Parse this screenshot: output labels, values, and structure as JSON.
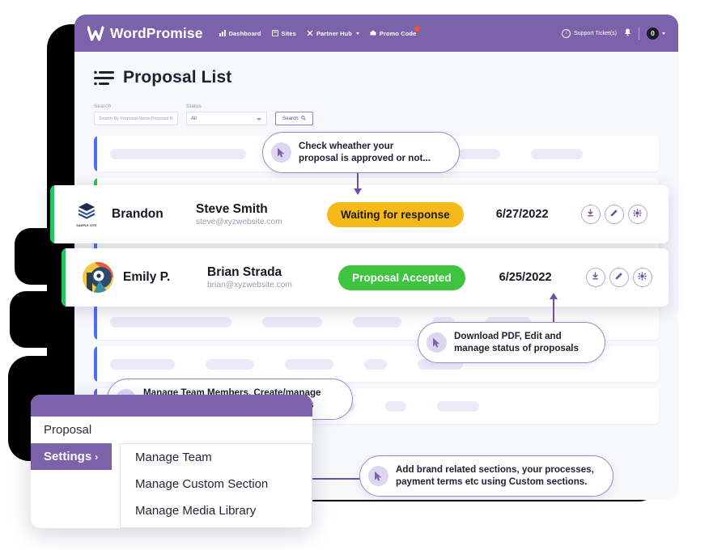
{
  "topnav": {
    "brand": "WordPromise",
    "links": [
      {
        "label": "Dashboard",
        "icon": "dashboard-icon",
        "caret": false,
        "badge": false
      },
      {
        "label": "Sites",
        "icon": "sites-icon",
        "caret": false,
        "badge": false
      },
      {
        "label": "Partner Hub",
        "icon": "partner-hub-icon",
        "caret": true,
        "badge": false
      },
      {
        "label": "Promo Code",
        "icon": "promo-code-icon",
        "caret": false,
        "badge": true
      }
    ],
    "support_label": "Support Ticket(s)",
    "avatar_initial": "0",
    "bg_color": "#7b62ab"
  },
  "page": {
    "title": "Proposal List",
    "title_icon": "list-icon"
  },
  "filters": {
    "search_label": "Search",
    "search_placeholder": "Search By Proposal Name,Proposal No.,Client",
    "search_value": "",
    "status_label": "Status",
    "status_value": "All",
    "status_options": [
      "All"
    ],
    "search_button": "Search"
  },
  "proposals": [
    {
      "logo_caption": "SAMPLE SITE",
      "owner": "Brandon",
      "client_name": "Steve Smith",
      "client_email": "steve@xyzwebsite.com",
      "status": "Waiting for response",
      "status_color": "#f5b91a",
      "date": "6/27/2022",
      "actions": [
        "download-icon",
        "edit-icon",
        "gear-icon"
      ],
      "edge_color": "#22c55e"
    },
    {
      "logo_caption": "",
      "owner": "Emily P.",
      "client_name": "Brian Strada",
      "client_email": "brian@xyzwebsite.com",
      "status": "Proposal Accepted",
      "status_color": "#3ec43e",
      "date": "6/25/2022",
      "actions": [
        "download-icon",
        "edit-icon",
        "gear-icon"
      ],
      "edge_color": "#22c55e"
    }
  ],
  "skeleton_rows": [
    {
      "edge_color": "#4c6ef5"
    },
    {
      "edge_color": "#22c55e"
    },
    {
      "edge_color": "#4c6ef5"
    },
    {
      "edge_color": "#22c55e"
    },
    {
      "edge_color": "#4c6ef5"
    },
    {
      "edge_color": "#4c6ef5"
    },
    {
      "edge_color": "#4c6ef5"
    }
  ],
  "tooltips": [
    {
      "text": "Check wheather your\nproposal is approved or not...",
      "icon": "cursor-icon"
    },
    {
      "text": "Download PDF, Edit and\nmanage status of proposals",
      "icon": "cursor-icon"
    },
    {
      "text": "Manage Team Members, Create/manage\ncustom sections, Manage Media Items",
      "icon": "cursor-icon"
    },
    {
      "text": "Add brand related sections, your processes,\npayment terms etc using Custom sections.",
      "icon": "cursor-icon"
    }
  ],
  "settings_panel": {
    "menu": [
      {
        "label": "Proposal",
        "active": false,
        "chevron": ""
      },
      {
        "label": "Settings",
        "active": true,
        "chevron": "›"
      }
    ],
    "submenu": [
      {
        "label": "Manage Team"
      },
      {
        "label": "Manage Custom Section"
      },
      {
        "label": "Manage Media Library"
      }
    ]
  },
  "colors": {
    "brand_purple": "#7b62ab",
    "accent_purple": "#6f4fa8",
    "amber": "#f5b91a",
    "green": "#3ec43e",
    "blue_edge": "#4c6ef5",
    "skeleton": "#eceaf8"
  }
}
